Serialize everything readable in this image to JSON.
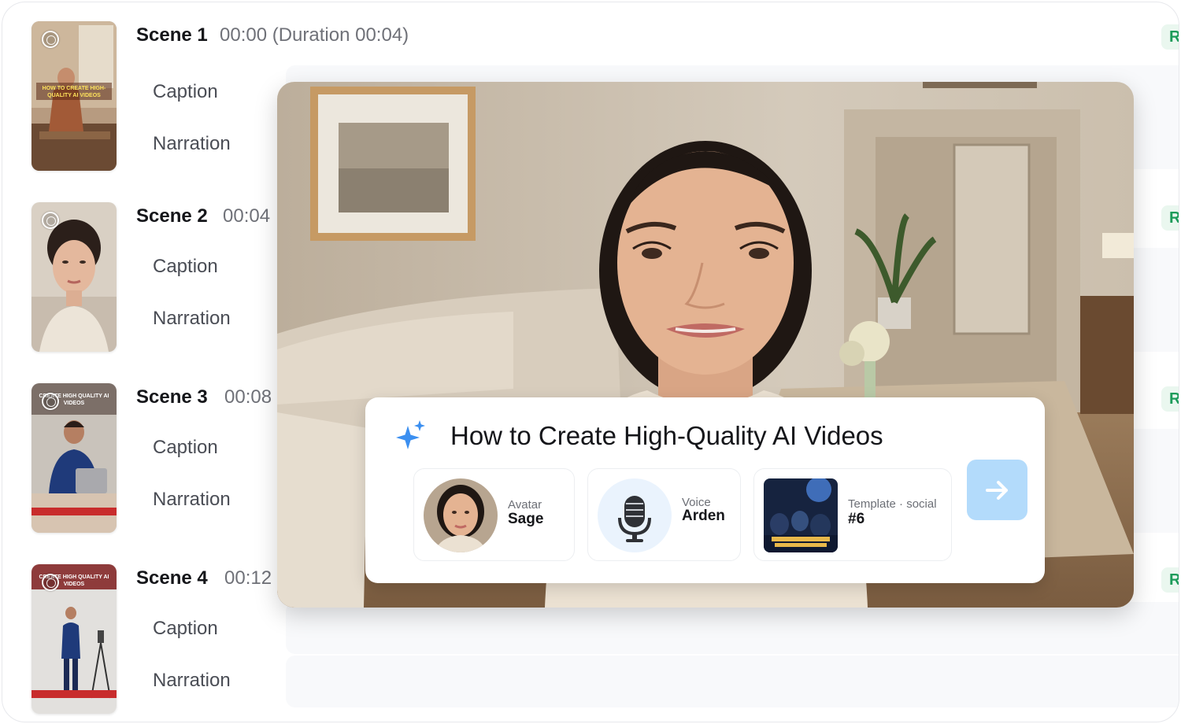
{
  "scenes": [
    {
      "title": "Scene 1",
      "time": "00:00 (Duration 00:04)",
      "caption_label": "Caption",
      "narration_label": "Narration",
      "badge": "R",
      "thumb_text": "HOW TO CREATE HIGH-QUALITY AI VIDEOS"
    },
    {
      "title": "Scene 2",
      "time": "00:04",
      "caption_label": "Caption",
      "narration_label": "Narration",
      "badge": "R",
      "thumb_text": ""
    },
    {
      "title": "Scene 3",
      "time": "00:08",
      "caption_label": "Caption",
      "narration_label": "Narration",
      "badge": "R",
      "thumb_text": "CREATE HIGH QUALITY AI VIDEOS"
    },
    {
      "title": "Scene 4",
      "time": "00:12",
      "caption_label": "Caption",
      "narration_label": "Narration",
      "badge": "R",
      "thumb_text": "CREATE HIGH QUALITY AI VIDEOS"
    }
  ],
  "prompt_card": {
    "title": "How to Create High-Quality AI Videos",
    "avatar": {
      "label": "Avatar",
      "value": "Sage"
    },
    "voice": {
      "label": "Voice",
      "value": "Arden"
    },
    "template": {
      "label": "Template · social",
      "value": "#6"
    }
  },
  "colors": {
    "accent_blue": "#3b8ff0",
    "next_button": "#b3dbfb",
    "badge_green": "#1c9b5a"
  },
  "icons": [
    "sparkle-icon",
    "microphone-icon",
    "arrow-right-icon",
    "radio-icon"
  ]
}
